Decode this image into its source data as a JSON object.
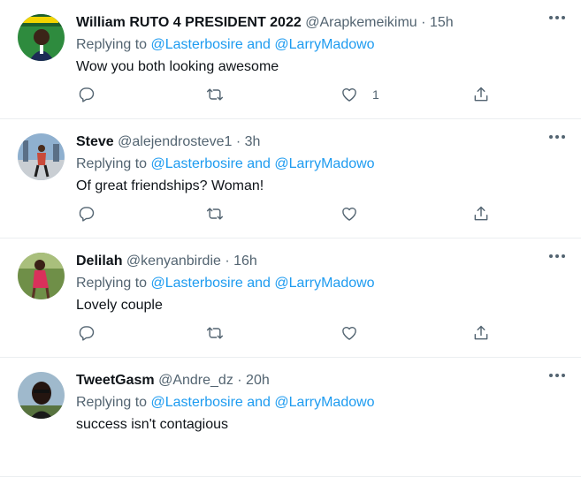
{
  "tweets": [
    {
      "name": "William RUTO 4 PRESIDENT 2022",
      "handle": "@Arapkemeikimu",
      "dot": "·",
      "time": "15h",
      "replying_prefix": "Replying to",
      "mention1": "@Lasterbosire",
      "and": "and",
      "mention2": "@LarryMadowo",
      "text": "Wow you both looking awesome",
      "like_count": "1",
      "avatar_colors": [
        "#2e8b3e",
        "#1d5f2c"
      ]
    },
    {
      "name": "Steve",
      "handle": "@alejendrosteve1",
      "dot": "·",
      "time": "3h",
      "replying_prefix": "Replying to",
      "mention1": "@Lasterbosire",
      "and": "and",
      "mention2": "@LarryMadowo",
      "text": "Of great friendships? Woman!",
      "like_count": "",
      "avatar_colors": [
        "#6d8fb1",
        "#c94a3a"
      ]
    },
    {
      "name": "Delilah",
      "handle": "@kenyanbirdie",
      "dot": "·",
      "time": "16h",
      "replying_prefix": "Replying to",
      "mention1": "@Lasterbosire",
      "and": "and",
      "mention2": "@LarryMadowo",
      "text": "Lovely couple",
      "like_count": "",
      "avatar_colors": [
        "#5d7d3a",
        "#d9315b"
      ]
    },
    {
      "name": "TweetGasm",
      "handle": "@Andre_dz",
      "dot": "·",
      "time": "20h",
      "replying_prefix": "Replying to",
      "mention1": "@Lasterbosire",
      "and": "and",
      "mention2": "@LarryMadowo",
      "text": "success isn't contagious",
      "like_count": "",
      "avatar_colors": [
        "#7a9bb5",
        "#1a1a1a"
      ]
    }
  ],
  "icons": {
    "reply": "reply-icon",
    "retweet": "retweet-icon",
    "like": "heart-icon",
    "share": "share-icon",
    "more": "more-icon"
  },
  "colors": {
    "link": "#1d9bf0",
    "secondary": "#536471",
    "text": "#0f1419"
  }
}
